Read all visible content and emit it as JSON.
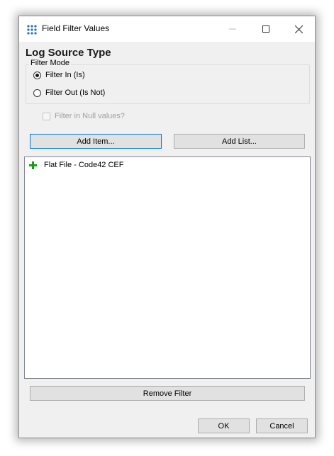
{
  "window": {
    "title": "Field Filter Values"
  },
  "field_title": "Log Source Type",
  "filter_mode": {
    "legend": "Filter Mode",
    "options": [
      {
        "label": "Filter In (Is)",
        "selected": true
      },
      {
        "label": "Filter Out (Is Not)",
        "selected": false
      }
    ]
  },
  "null_checkbox": {
    "label": "Filter in Null values?",
    "checked": false,
    "enabled": false
  },
  "buttons": {
    "add_item": "Add Item...",
    "add_list": "Add List...",
    "remove_filter": "Remove Filter",
    "ok": "OK",
    "cancel": "Cancel"
  },
  "values_list": [
    {
      "icon": "plus-icon",
      "label": "Flat File - Code42 CEF"
    }
  ],
  "colors": {
    "plus": "#11a011",
    "focus_border": "#0078d7",
    "app_icon": "#1e6ec8"
  }
}
